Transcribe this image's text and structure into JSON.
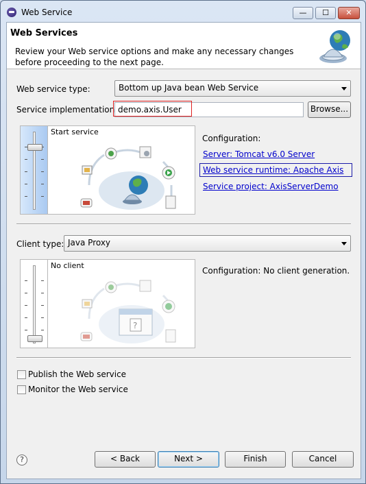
{
  "window": {
    "title": "Web Service",
    "controls": {
      "minimize": "—",
      "maximize": "☐",
      "close": "✕"
    }
  },
  "banner": {
    "heading": "Web Services",
    "description": "Review your Web service options and make any necessary changes before proceeding to the next page."
  },
  "service": {
    "type_label": "Web service type:",
    "type_value": "Bottom up Java bean Web Service",
    "impl_label": "Service implementation:",
    "impl_value": "demo.axis.User",
    "browse_label": "Browse...",
    "level_label": "Start service",
    "config_heading": "Configuration:",
    "server_link": "Server: Tomcat v6.0 Server",
    "runtime_link": "Web service runtime: Apache Axis",
    "project_link": "Service project: AxisServerDemo"
  },
  "client": {
    "type_label": "Client type:",
    "type_value": "Java Proxy",
    "level_label": "No client",
    "config_text": "Configuration: No client generation."
  },
  "options": {
    "publish_label": "Publish the Web service",
    "publish_checked": false,
    "monitor_label": "Monitor the Web service",
    "monitor_checked": false
  },
  "footer": {
    "help_label": "?",
    "back_label": "< Back",
    "next_label": "Next >",
    "finish_label": "Finish",
    "cancel_label": "Cancel"
  },
  "colors": {
    "link": "#0000cc",
    "highlight_red": "#e02020",
    "highlight_blue": "#1a1aa8"
  }
}
